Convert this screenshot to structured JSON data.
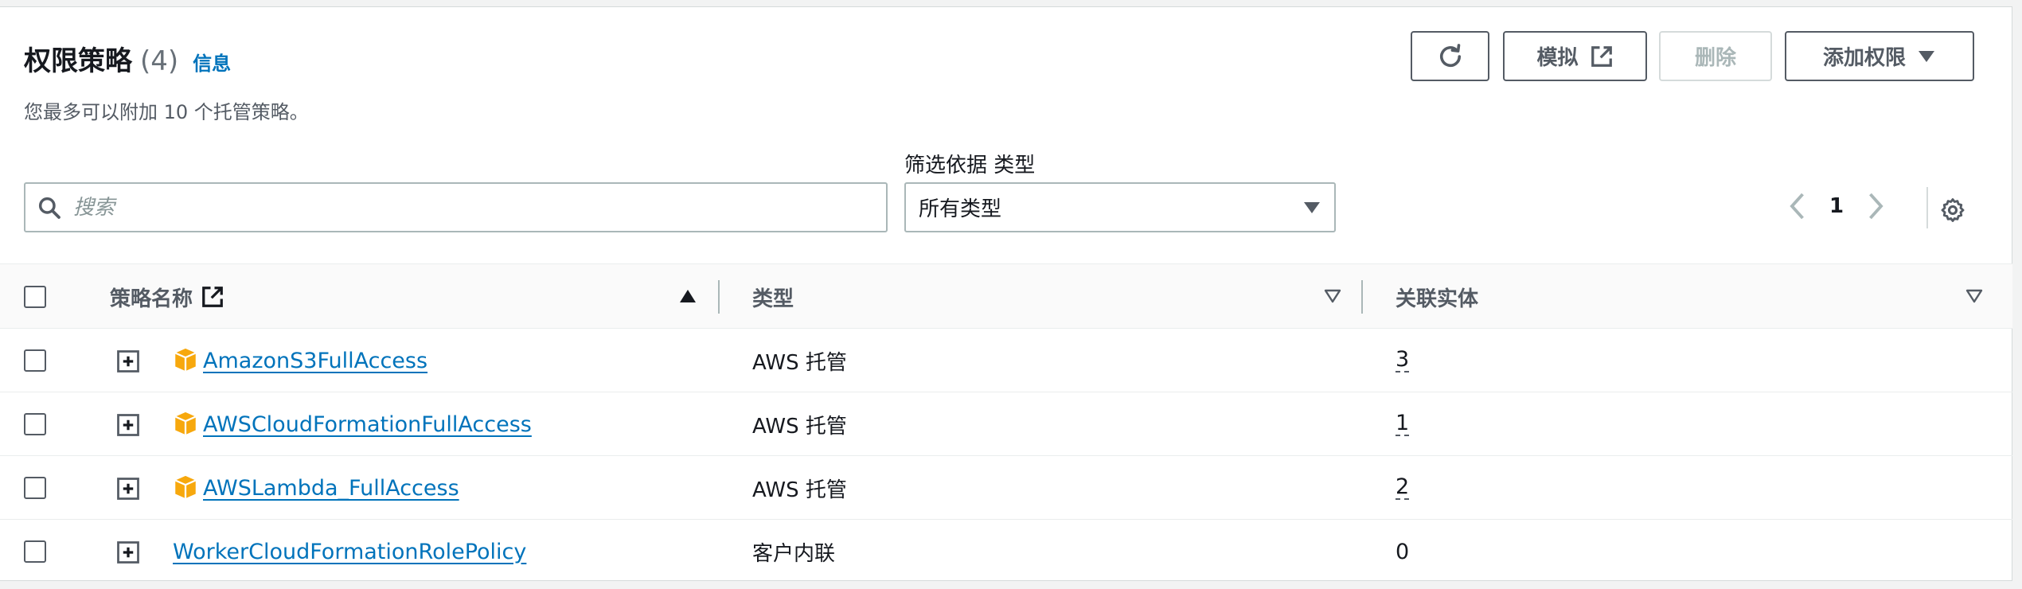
{
  "header": {
    "title": "权限策略",
    "count": "(4)",
    "info_link": "信息",
    "subtitle": "您最多可以附加 10 个托管策略。"
  },
  "toolbar": {
    "refresh_icon": "refresh-icon",
    "simulate_label": "模拟",
    "simulate_icon": "external-link-icon",
    "delete_label": "删除",
    "add_permissions_label": "添加权限",
    "add_permissions_icon": "caret-down-icon"
  },
  "search": {
    "placeholder": "搜索",
    "value": ""
  },
  "filter": {
    "label": "筛选依据 类型",
    "selected": "所有类型"
  },
  "pagination": {
    "current_page": "1"
  },
  "table": {
    "columns": [
      {
        "label": "策略名称",
        "sort": "ascending",
        "external_icon": "external-link-icon"
      },
      {
        "label": "类型",
        "sort": "none"
      },
      {
        "label": "关联实体",
        "sort": "none"
      }
    ],
    "rows": [
      {
        "name": "AmazonS3FullAccess",
        "type": "AWS 托管",
        "entities": "3",
        "aws_managed": true
      },
      {
        "name": "AWSCloudFormationFullAccess",
        "type": "AWS 托管",
        "entities": "1",
        "aws_managed": true
      },
      {
        "name": "AWSLambda_FullAccess",
        "type": "AWS 托管",
        "entities": "2",
        "aws_managed": true
      },
      {
        "name": "WorkerCloudFormationRolePolicy",
        "type": "客户内联",
        "entities": "0",
        "aws_managed": false
      }
    ]
  },
  "colors": {
    "link": "#0073bb",
    "aws_icon": "#f7a80d",
    "border": "#aab7b8"
  }
}
